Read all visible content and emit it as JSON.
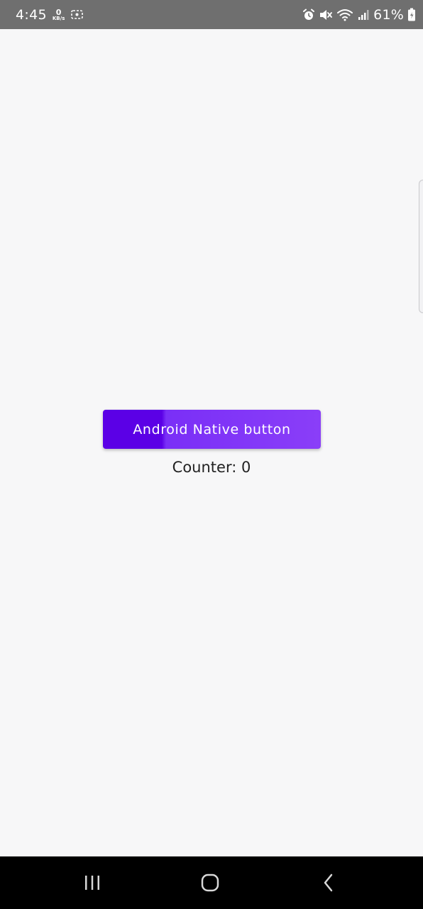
{
  "status_bar": {
    "time": "4:45",
    "net_speed_value": "0",
    "net_speed_unit": "KB/s",
    "battery_percent": "61%",
    "icons": [
      "network-speed-icon",
      "screen-record-icon",
      "alarm-icon",
      "mute-icon",
      "wifi-icon",
      "signal-icon",
      "battery-icon"
    ]
  },
  "main": {
    "button_label": "Android Native button",
    "counter_text": "Counter: 0"
  },
  "colors": {
    "button_primary": "#5b00e6",
    "button_secondary": "#8a3ef8",
    "background": "#f7f7f8",
    "status_bar": "#6f6f6f",
    "nav_bar": "#000000"
  },
  "nav_bar": {
    "icons": [
      "recents-icon",
      "home-icon",
      "back-icon"
    ]
  }
}
